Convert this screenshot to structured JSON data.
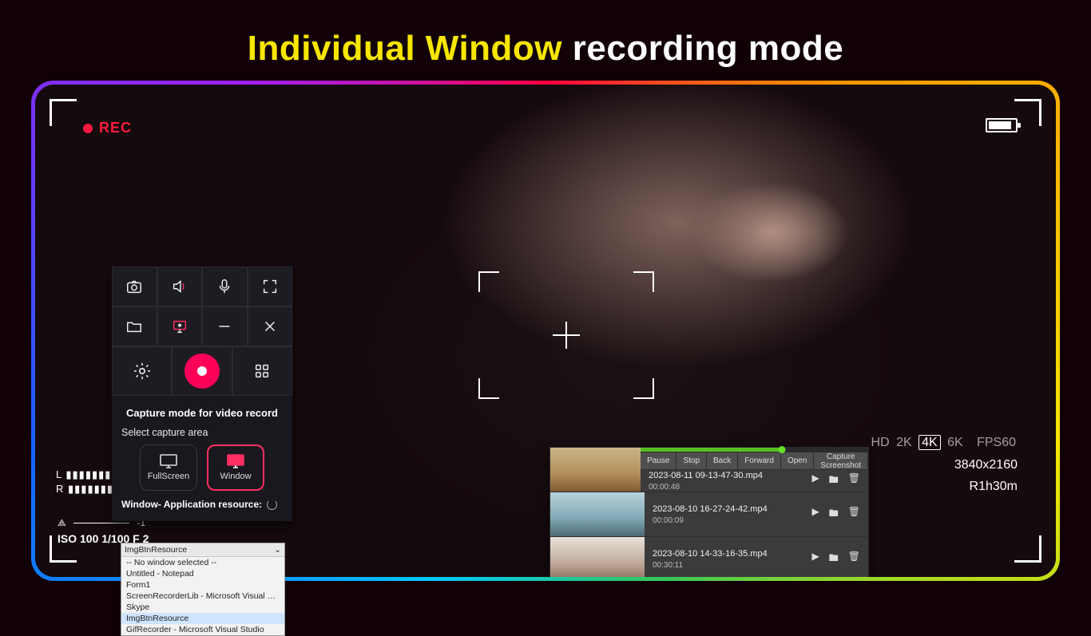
{
  "headline": {
    "accent": "Individual Window",
    "rest": "recording mode"
  },
  "viewfinder": {
    "rec": "REC",
    "left": {
      "vu_l": "L  ▮▮▮▮▮▮▮▮▮▮▮▮▮▮▮",
      "vu_r": "R  ▮▮▮▮▮▮▮▮▮▮▮",
      "scale_lead": "⟁",
      "scale_value": "-1",
      "iso": "ISO 100 1/100  F 2"
    },
    "right": {
      "quals": [
        "HD",
        "2K",
        "4K",
        "6K"
      ],
      "qual_selected": "4K",
      "fps": "FPS60",
      "res": "3840x2160",
      "remain": "R1h30m"
    }
  },
  "toolbox": {
    "icons": [
      "camera-icon",
      "speaker-icon",
      "mic-icon",
      "fullscreen-icon",
      "folder-icon",
      "monitor-icon",
      "minimize-icon",
      "close-icon"
    ],
    "bottom_icons": [
      "settings-icon",
      "record-icon",
      "apps-icon"
    ],
    "title": "Capture mode for video record",
    "subtitle": "Select capture area",
    "options": [
      {
        "label": "FullScreen",
        "selected": false
      },
      {
        "label": "Window",
        "selected": true
      }
    ],
    "window_row": "Window- Application resource:"
  },
  "dropdown": {
    "selected": "ImgBtnResource",
    "items": [
      "-- No window selected --",
      "Untitled - Notepad",
      "Form1",
      "ScreenRecorderLib - Microsoft Visual Studio",
      "Skype",
      "ImgBtnResource",
      "GifRecorder - Microsoft Visual Studio"
    ],
    "highlighted_index": 5
  },
  "player": {
    "controls": [
      "Pause",
      "Stop",
      "Back",
      "Forward",
      "Open",
      "Capture Screenshot"
    ],
    "entries": [
      {
        "file": "2023-08-11 09-13-47-30.mp4",
        "dur": "00:00:48"
      },
      {
        "file": "2023-08-10 16-27-24-42.mp4",
        "dur": "00:00:09"
      },
      {
        "file": "2023-08-10 14-33-16-35.mp4",
        "dur": "00:30:11"
      }
    ]
  }
}
